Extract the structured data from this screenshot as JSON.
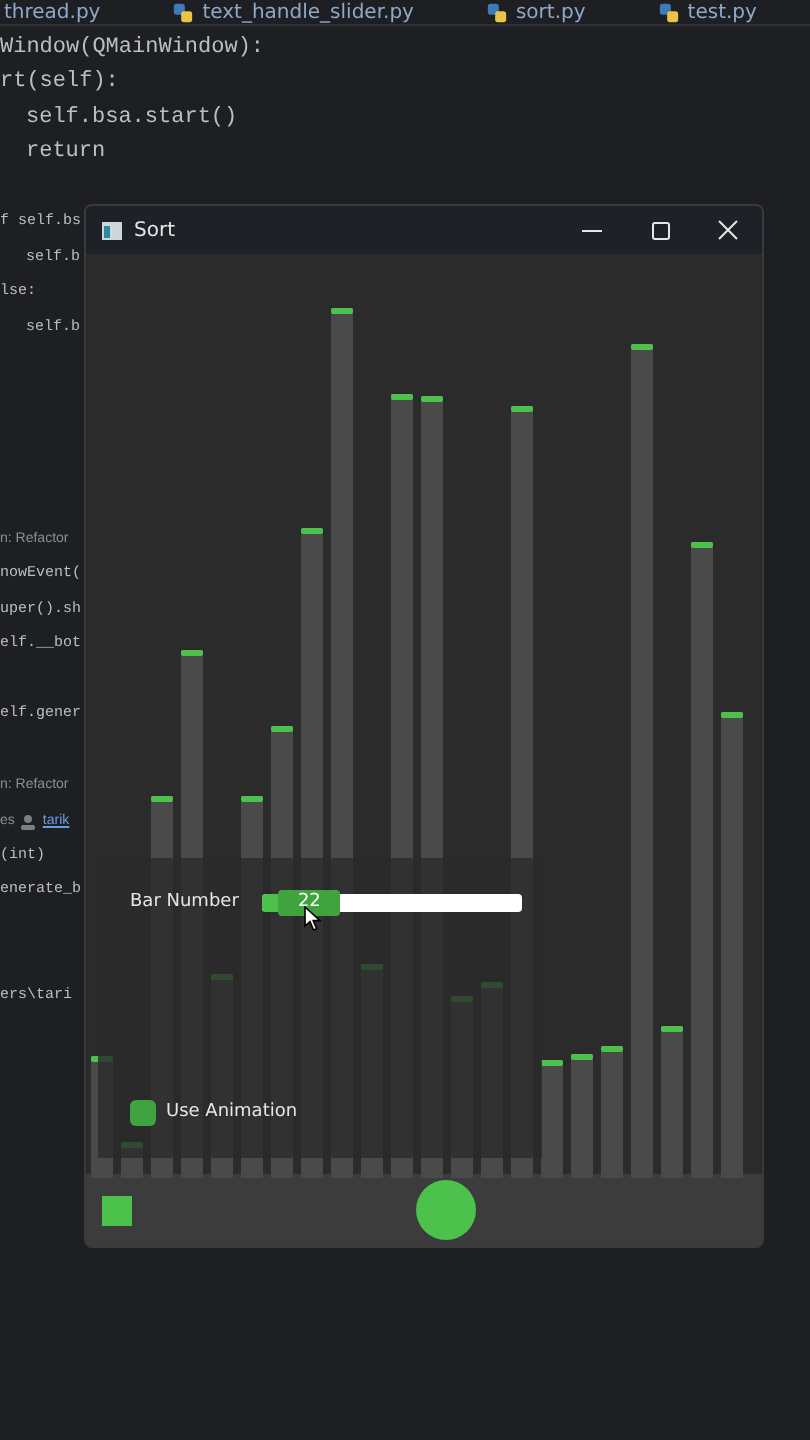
{
  "editor": {
    "tabs": [
      {
        "label": "thread.py",
        "icon": false
      },
      {
        "label": "text_handle_slider.py",
        "icon": true
      },
      {
        "label": "sort.py",
        "icon": true
      },
      {
        "label": "test.py",
        "icon": true
      }
    ],
    "lines": [
      {
        "kind": "code",
        "indented": false,
        "text": "Window(QMainWindow):"
      },
      {
        "kind": "code",
        "indented": false,
        "text": "rt(self):"
      },
      {
        "kind": "code",
        "indented": true,
        "text": "self.bsa.start()"
      },
      {
        "kind": "code",
        "indented": true,
        "text": "return"
      },
      {
        "kind": "code",
        "indented": false,
        "text": "f self.bs"
      },
      {
        "kind": "code",
        "indented": true,
        "text": "self.b"
      },
      {
        "kind": "code",
        "indented": false,
        "text": "lse:"
      },
      {
        "kind": "code",
        "indented": true,
        "text": "self.b"
      },
      {
        "kind": "hint",
        "text": "n: Refactor"
      },
      {
        "kind": "code",
        "indented": false,
        "text": "nowEvent("
      },
      {
        "kind": "code",
        "indented": false,
        "text": "uper().sh"
      },
      {
        "kind": "code",
        "indented": false,
        "text": "elf.__bot"
      },
      {
        "kind": "code",
        "indented": false,
        "text": "elf.gener"
      },
      {
        "kind": "hint",
        "text": "n: Refactor"
      },
      {
        "kind": "author",
        "text": "es",
        "author": "tarik"
      },
      {
        "kind": "code",
        "indented": false,
        "text": "(int)"
      },
      {
        "kind": "code",
        "indented": false,
        "text": "enerate_b"
      },
      {
        "kind": "code",
        "indented": false,
        "text": "ers\\tari"
      }
    ]
  },
  "window": {
    "title": "Sort",
    "slider": {
      "label": "Bar Number",
      "value": "22",
      "level": 0.06
    },
    "checkbox": {
      "label": "Use Animation",
      "checked": true
    }
  }
}
